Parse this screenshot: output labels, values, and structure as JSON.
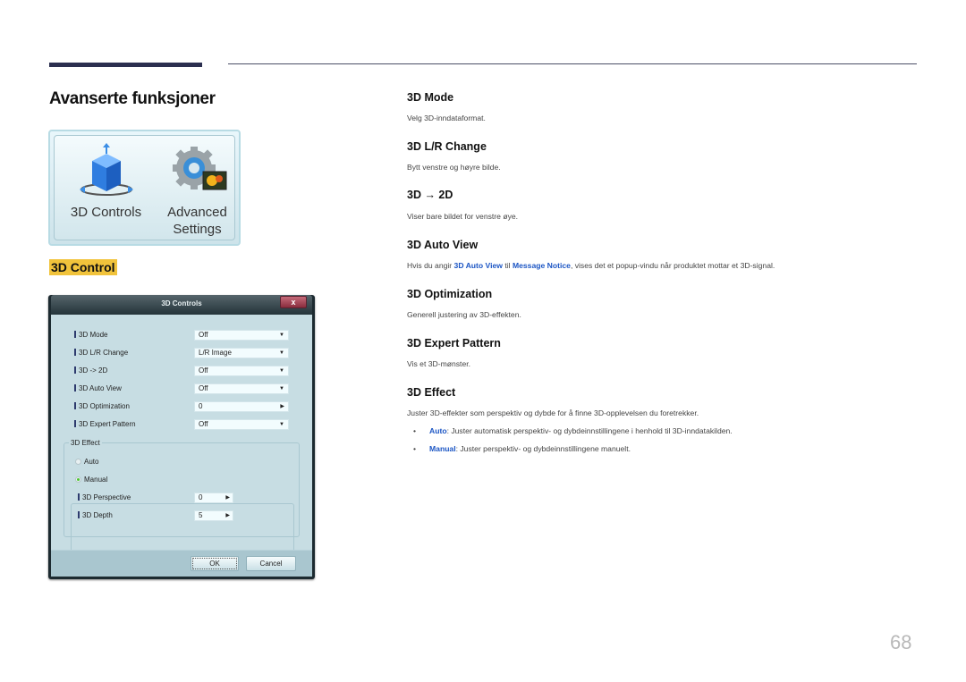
{
  "page": {
    "title": "Avanserte funksjoner",
    "section_badge": "3D Control",
    "page_number": "68"
  },
  "icon_panel": {
    "tiles": [
      {
        "label_line1": "3D Controls",
        "label_line2": "",
        "icon": "3d-cube-icon"
      },
      {
        "label_line1": "Advanced",
        "label_line2": "Settings",
        "icon": "gear-picture-icon"
      }
    ]
  },
  "dialog": {
    "title": "3D Controls",
    "close_label": "x",
    "rows": [
      {
        "label": "3D Mode",
        "type": "select",
        "value": "Off"
      },
      {
        "label": "3D L/R Change",
        "type": "select",
        "value": "L/R Image"
      },
      {
        "label": "3D -> 2D",
        "type": "select",
        "value": "Off"
      },
      {
        "label": "3D Auto View",
        "type": "select",
        "value": "Off"
      },
      {
        "label": "3D Optimization",
        "type": "spinner",
        "value": "0"
      },
      {
        "label": "3D Expert Pattern",
        "type": "select",
        "value": "Off"
      }
    ],
    "effect_group": {
      "label": "3D Effect",
      "options": [
        {
          "label": "Auto",
          "selected": false
        },
        {
          "label": "Manual",
          "selected": true
        }
      ],
      "manual_rows": [
        {
          "label": "3D Perspective",
          "value": "0"
        },
        {
          "label": "3D Depth",
          "value": "5"
        }
      ]
    },
    "buttons": {
      "ok": "OK",
      "cancel": "Cancel"
    }
  },
  "sections": [
    {
      "heading": "3D Mode",
      "text": "Velg 3D-inndataformat."
    },
    {
      "heading": "3D L/R Change",
      "text": "Bytt venstre og høyre bilde."
    },
    {
      "heading": "3D → 2D",
      "text": "Viser bare bildet for venstre øye."
    },
    {
      "heading": "3D Auto View",
      "text_pre": "Hvis du angir ",
      "bold1": "3D Auto View",
      "text_mid": " til ",
      "bold2": "Message Notice",
      "text_post": ", vises det et popup-vindu når produktet mottar et 3D-signal."
    },
    {
      "heading": "3D Optimization",
      "text": "Generell justering av 3D-effekten."
    },
    {
      "heading": "3D Expert Pattern",
      "text": "Vis et 3D-mønster."
    },
    {
      "heading": "3D Effect",
      "text": "Juster 3D-effekter som perspektiv og dybde for å finne 3D-opplevelsen du foretrekker.",
      "bullets": [
        {
          "term": "Auto",
          "text": ": Juster automatisk perspektiv- og dybdeinnstillingene i henhold til 3D-inndatakilden."
        },
        {
          "term": "Manual",
          "text": ": Juster perspektiv- og dybdeinnstillingene manuelt."
        }
      ]
    }
  ],
  "colors": {
    "accent_link": "#1b55c4",
    "badge": "#f1c33b",
    "rule": "#2b2f4f"
  }
}
